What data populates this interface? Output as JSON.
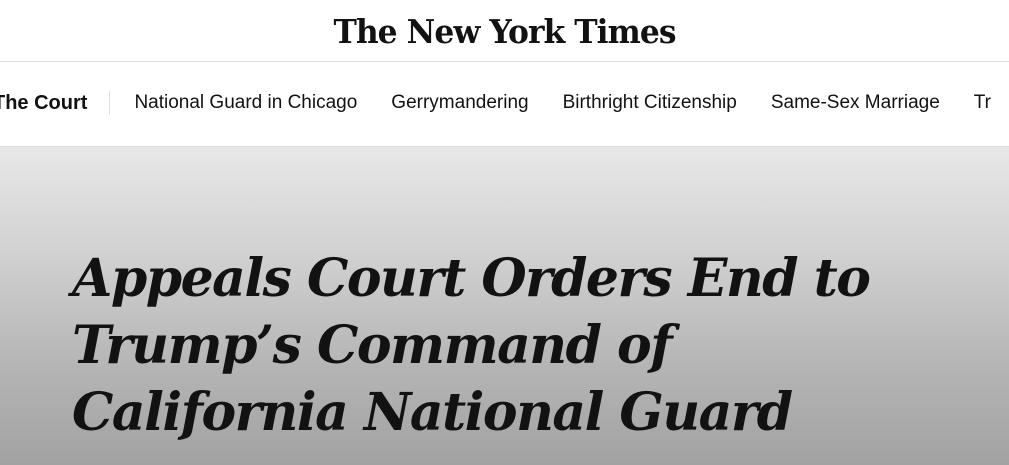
{
  "masthead": {
    "logo_text": "The New York Times"
  },
  "topic_nav": {
    "current_label": "The Court",
    "items": [
      {
        "label": "National Guard in Chicago"
      },
      {
        "label": "Gerrymandering"
      },
      {
        "label": "Birthright Citizenship"
      },
      {
        "label": "Same-Sex Marriage"
      },
      {
        "label": "Tr"
      }
    ]
  },
  "article": {
    "headline": "Appeals Court Orders End to Trump’s Command of California National Guard"
  },
  "colors": {
    "text": "#121212",
    "divider": "#dfdfdf",
    "hero_gradient_top": "#e8e8e8",
    "hero_gradient_bottom": "#a2a2a2"
  }
}
